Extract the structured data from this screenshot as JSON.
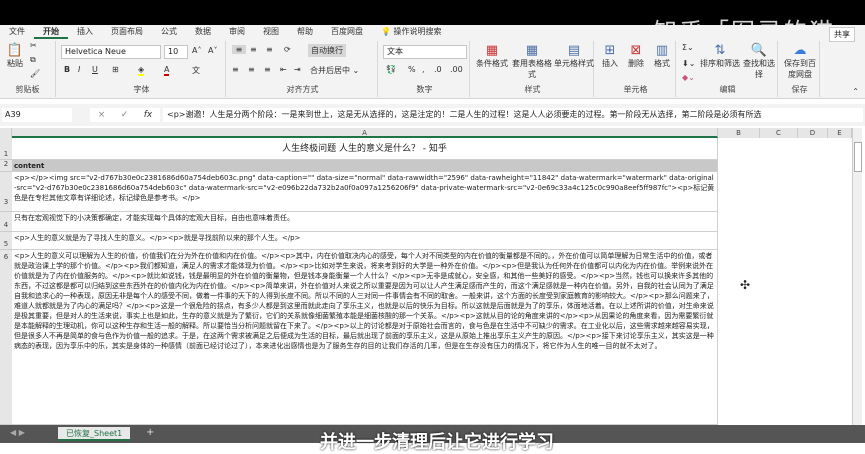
{
  "watermark": "知乎「图灵的猫",
  "share": "共享",
  "menu_tabs": [
    "文件",
    "开始",
    "插入",
    "页面布局",
    "公式",
    "数据",
    "审阅",
    "视图",
    "帮助",
    "百度网盘",
    "操作说明搜索"
  ],
  "clipboard": {
    "paste": "粘贴",
    "label": "剪贴板"
  },
  "font": {
    "name": "Helvetica Neue",
    "size": "10",
    "label": "字体",
    "bold": "B",
    "italic": "I",
    "underline": "U"
  },
  "align": {
    "wrap": "自动换行",
    "merge": "合并后居中",
    "label": "对齐方式"
  },
  "number": {
    "format": "文本",
    "percent": "%",
    "comma": ",",
    "label": "数字"
  },
  "styles": {
    "cond": "条件格式",
    "table": "套用表格格式",
    "cell": "单元格样式",
    "label": "样式"
  },
  "cells": {
    "insert": "插入",
    "delete": "删除",
    "format": "格式",
    "label": "单元格"
  },
  "editing": {
    "sort": "排序和筛选",
    "find": "查找和选择",
    "label": "编辑"
  },
  "protect": {
    "save": "保存到百度网盘",
    "label": "保存"
  },
  "formula_bar": {
    "name_box": "A39",
    "cancel": "×",
    "enter": "✓",
    "fx": "fx",
    "content": "<p>谢邀！人生是分两个阶段：一是来到世上，这是无从选择的，这是注定的！二是人生的过程！这是人人必须要走的过程。第一阶段无从选择，第二阶段是必须有所选"
  },
  "columns": [
    "A",
    "B",
    "C",
    "D",
    "E"
  ],
  "rows": [
    {
      "num": "1",
      "text": "人生终极问题 人生的意义是什么？ - 知乎"
    },
    {
      "num": "2",
      "text": "content"
    },
    {
      "num": "3",
      "text": "<p></p><img src=\"v2-d767b30e0c2381686d60a754deb603c.png\" data-caption=\"\" data-size=\"normal\" data-rawwidth=\"2596\" data-rawheight=\"11842\" data-watermark=\"watermark\" data-original-src=\"v2-d767b30e0c2381686d60a754deb603c\" data-watermark-src=\"v2-e096b22da732b2a0f0a097a1256206f9\" data-private-watermark-src=\"v2-0e69c33a4c125c0c990a8eef5ff987fc\"><p>标记黄色是在专栏其他文章有详细论述，标记绿色是参考书。</p>"
    },
    {
      "num": "4",
      "text": "只有在宏观视觉下的小决策都确定，才能实现每个具体的宏观大目标，自由也意味着责任。"
    },
    {
      "num": "5",
      "text": "<p>人生的意义就是为了寻找人生的意义。</p><p>就是寻找前阶以来的那个人生。</p>"
    },
    {
      "num": "6",
      "text": "<p>人生的意义可以理解为人生的价值，价值我们在分为外在价值和内在价值。</p><p>其中，内在价值取决内心的感受，每个人对不同类型的内在价值的衡量都是不同的。，外在价值可以简单理解为日常生活中的价值，或者就是政治课上学的那个价值。</p><p>我们都知道，满足人的需求才能体现为价值。</p><p>比如对学生来说，将来考到好的大学是一种外在价值。</p><p>但是我认为任何外在价值都可以内化为内在价值。举例来说外在价值就是为了内在价值服务的。</p><p>就比如说钱，钱是最明显的外在价值的衡量物，但是钱本身能衡量一个人什么？</p><p>无非是成就心，安全感，和其他一些美好的感受。</p><p>当然，钱也可以换来许多其他的东西，不过这都是都可以归结到这些东西外在的价值内化为内在价值。</p><p>简单来讲，外在价值对人来说之所以重要是因为可以让人产生满足感而产生的，而这个满足感就是一种内在价值。另外，自我的社会认同为了满足自我和追求心的一种表现，原因无非是每个人的感受不同，做着一件事的天下的人得到长度不同。所以不同的人三对同一件事情会有不同的取舍。一般来讲，这个方面的长度受到家庭教育的影响较大。</p><p>那么问题来了，难道人就都就是为了内心的满足吗？</p><p>这是一个很危险的拐点，有多少人都是到这里而就此走向了享乐主义，也就是以后的快乐为目标。所以这就是后面就是为了的享乐，体面地活着。在以上述所讲的价值，对生命来说是极其重要，但是对人的生活来说，事实上也是如此，生存的意义就是为了繁衍，它们的关系就像细菌繁殖本能是细菌核酸的那一个关系。</p><p>这就从目的论的角度来讲的</p><p>从因果论的角度来看，因为需要繁衍就是本能解释的生理动机，你可以这种生存和生活一般的解释。所以要恰当分析问题就留在下来了。</p><p>以上的讨论都是对于原始社会而言的，食与色是在生活中不可缺少的需求。在工业化以后，这些需求越来越容易实现，但是很多人不再是简单的食与色作为价值一般的追求。于是，在这两个需求被满足之后便成为生活的目标，最后就出现了前面的享乐主义，这是从原始上推出享乐主义产生的原因。</p><p>接下来讨论享乐主义，其实这是一种病态的表现，因为享乐中的乐，其实是身体的一种感情（前面已经讨论过了），本来进化出感情也是为了服务生存的目的让我们存活的几率，但是在生存没有压力的情况下，将它作为人生的唯一目的就不太对了。"
    }
  ],
  "sheet_tab": "已恢复_Sheet1",
  "add_sheet": "+",
  "subtitle": "并进一步清理后让它进行学习"
}
